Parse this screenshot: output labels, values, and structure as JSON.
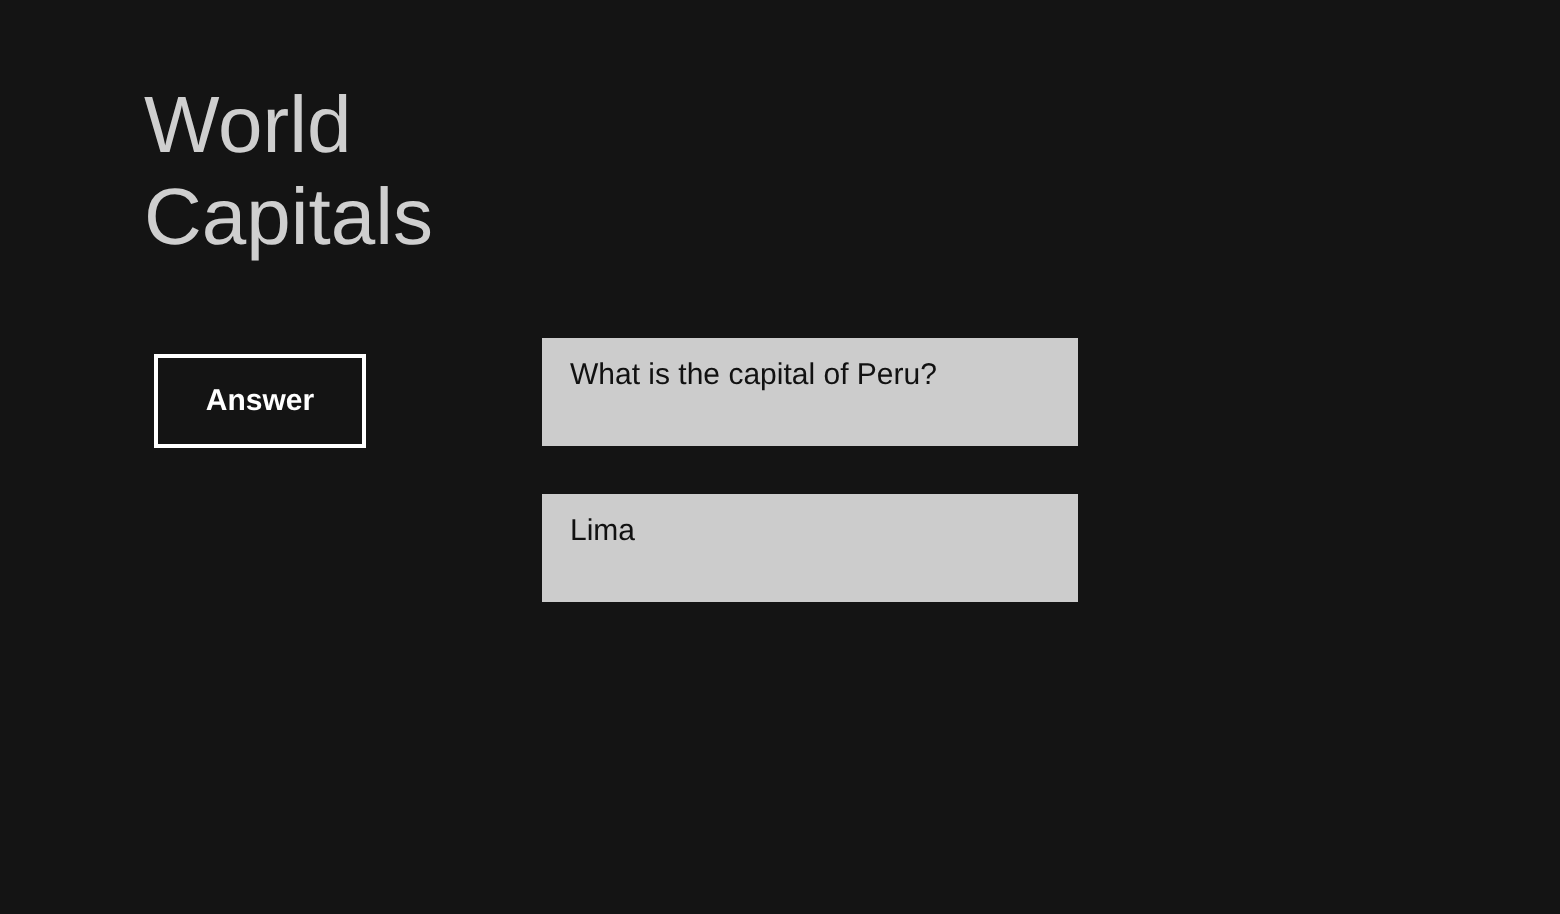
{
  "title": "World\nCapitals",
  "answer_button": {
    "label": "Answer"
  },
  "question": {
    "value": "What is the capital of Peru?"
  },
  "answer": {
    "value": "Lima"
  }
}
